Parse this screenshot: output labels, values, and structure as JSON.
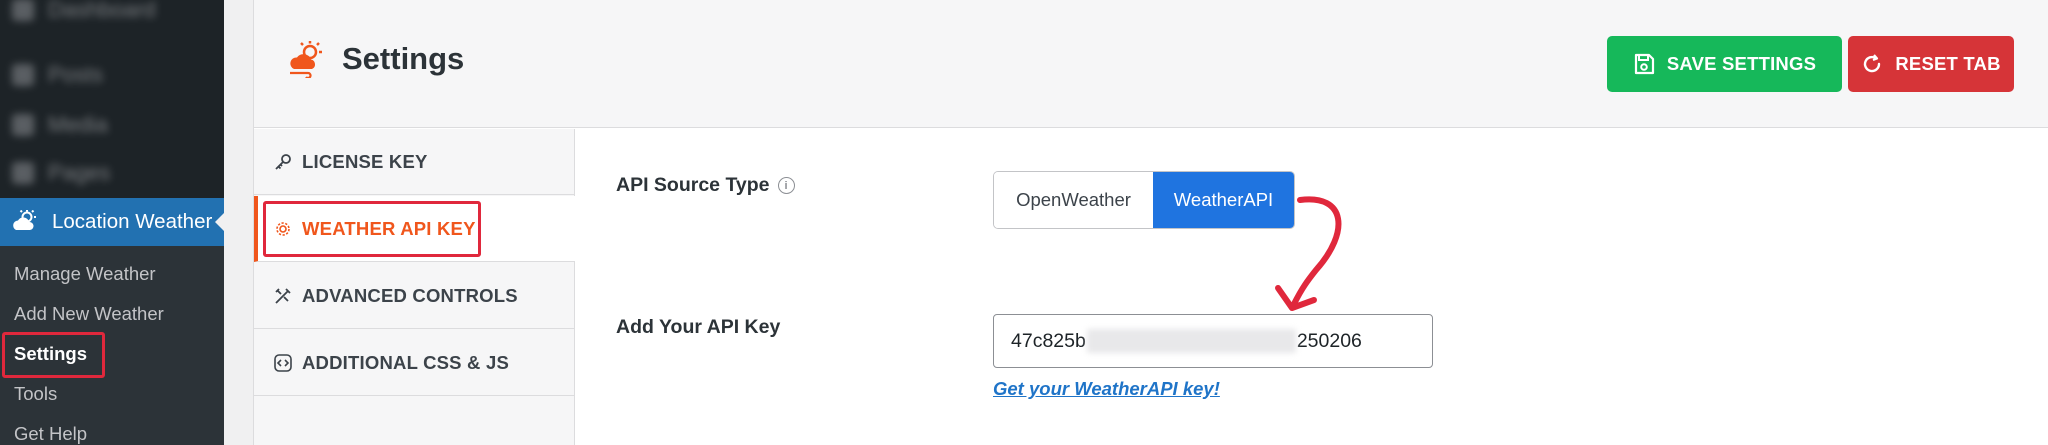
{
  "sidebar": {
    "blurred_items": [
      "Dashboard",
      "Posts",
      "Media",
      "Pages"
    ],
    "active_menu": "Location Weather",
    "submenu": [
      "Manage Weather",
      "Add New Weather",
      "Settings",
      "Tools",
      "Get Help"
    ],
    "current_submenu": "Settings"
  },
  "header": {
    "title": "Settings",
    "save_label": "SAVE SETTINGS",
    "reset_label": "RESET TAB"
  },
  "tabs": [
    {
      "label": "LICENSE KEY",
      "icon": "key-icon"
    },
    {
      "label": "WEATHER API KEY",
      "icon": "gear-icon"
    },
    {
      "label": "ADVANCED CONTROLS",
      "icon": "tools-icon"
    },
    {
      "label": "ADDITIONAL CSS & JS",
      "icon": "code-icon"
    }
  ],
  "content": {
    "api_source_label": "API Source Type",
    "api_source_options": [
      "OpenWeather",
      "WeatherAPI"
    ],
    "api_source_selected": "WeatherAPI",
    "api_key_label": "Add Your API Key",
    "api_key_prefix": "47c825b",
    "api_key_suffix": "250206",
    "api_link_text": "Get your WeatherAPI key!"
  },
  "colors": {
    "sidebar_bg": "#1d2327",
    "wp_blue": "#2271b1",
    "save_green": "#16b85a",
    "reset_red": "#d63438",
    "active_tab_orange": "#f0561c",
    "segment_blue": "#1f74e0",
    "annotation_red": "#e0283c"
  }
}
